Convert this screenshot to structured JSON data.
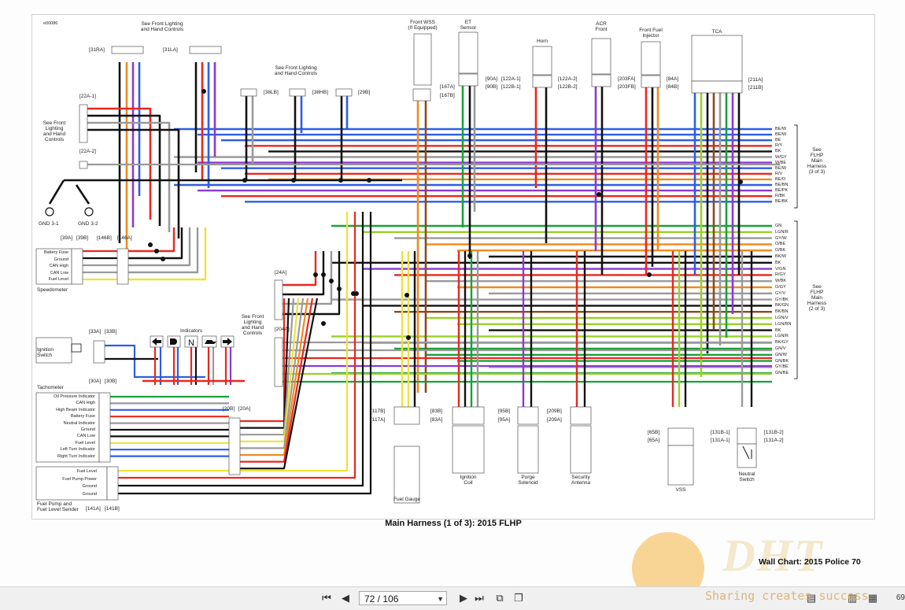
{
  "document": {
    "id_label": "e00086",
    "title": "Main Harness (1 of 3): 2015 FLHP",
    "footer": "Wall Chart:  2015 Police  70"
  },
  "labels": {
    "front_lighting_1": "See Front Lighting\nand Hand Controls",
    "front_lighting_2": "See Front Lighting\nand Hand Controls",
    "front_lighting_3": "See Front\nLighting\nand Hand\nControls",
    "front_lighting_4": "See Front\nLighting\nand Hand\nControls",
    "front_wss": "Front WSS\n(If Equipped)",
    "et_sensor": "ET\nSensor",
    "horn": "Horn",
    "acr_front": "ACR\nFront",
    "front_fuel_injector": "Front Fuel\nInjector",
    "tca": "TCA",
    "flhp_3": "See\nFLHP\nMain\nHarness\n(3 of 3)",
    "flhp_2": "See\nFLHP\nMain\nHarness\n(2 of 3)",
    "gnd_31": "GND 3-1",
    "gnd_32": "GND 3-2",
    "speedometer": "Speedometer",
    "ignition_switch": "Ignition\nSwitch",
    "indicators": "Indicators",
    "tachometer": "Tachometer",
    "fuel_pump": "Fuel Pump and\nFuel Level Sender",
    "fuel_gauge": "Fuel Gauge",
    "ignition_coil": "Ignition\nCoil",
    "purge_solenoid": "Purge\nSolenoid",
    "security_antenna": "Security\nAntenna",
    "vss": "VSS",
    "neutral_switch": "Neutral\nSwitch"
  },
  "connectors": {
    "c31ra": "[31RA]",
    "c31la": "[31LA]",
    "c38lb": "[38LB]",
    "c38hb": "[38HB]",
    "c29b": "[29B]",
    "c167a": "[167A]",
    "c167b": "[167B]",
    "c90a": "[90A]",
    "c90b": "[90B]",
    "c122a1": "[122A-1]",
    "c122b1": "[122B-1]",
    "c122a2": "[122A-2]",
    "c122b2": "[122B-2]",
    "c203fa": "[203FA]",
    "c203fb": "[203FB]",
    "c84a": "[84A]",
    "c84b": "[84B]",
    "c211a": "[211A]",
    "c211b": "[211B]",
    "c22a1": "[22A-1]",
    "c22a2": "[22A-2]",
    "c39a": "[39A]",
    "c39b": "[39B]",
    "c146b": "[146B]",
    "c146a": "[146A]",
    "c24a": "[24A]",
    "c204a": "[204A]",
    "c33a": "[33A]",
    "c33b": "[33B]",
    "c30a": "[30A]",
    "c30b": "[30B]",
    "c20b": "[20B]",
    "c20a": "[20A]",
    "c117b": "[117B]",
    "c117a": "[117A]",
    "c83b": "[83B]",
    "c83a": "[83A]",
    "c95b": "[95B]",
    "c95a": "[95A]",
    "c209b": "[209B]",
    "c209a": "[209A]",
    "c65b": "[65B]",
    "c65a": "[65A]",
    "c131b1": "[131B-1]",
    "c131a1": "[131A-1]",
    "c131b2": "[131B-2]",
    "c131a2": "[131A-2]",
    "c141a": "[141A]",
    "c141b": "[141B]"
  },
  "speedometer_pins": [
    "Battery Fuse",
    "Ground",
    "CAN High",
    "CAN Low",
    "Fuel Level"
  ],
  "tach_pins": [
    "Oil Pressure Indicator",
    "CAN High",
    "High Beam Indicator",
    "Battery Fuse",
    "Neutral Indicator",
    "Ground",
    "CAN Low",
    "Fuel Level",
    "Left Turn Indicator",
    "Right Turn Indicator"
  ],
  "fuel_pins": [
    "Fuel Level",
    "Fuel Pump Power",
    "Ground",
    "Ground"
  ],
  "right_wires_3": [
    "BE/W",
    "BE/W",
    "BE",
    "R/Y",
    "BK",
    "W/GY",
    "W/BE",
    "BE/W",
    "R/V",
    "BE/O",
    "BE/BN",
    "BE/PK",
    "R/BK",
    "BE/BK"
  ],
  "right_wires_2": [
    "GN",
    "LGN/R",
    "GY/W",
    "O/BE",
    "O/BK",
    "BK/W",
    "BK",
    "V/GN",
    "R/GY",
    "W/BK",
    "O/GY",
    "GY/V",
    "GY/BK",
    "BK/GN",
    "BK/BN",
    "LGN/V",
    "LGN/BN",
    "BK",
    "LGN/R",
    "BK/GY",
    "GN/V",
    "GN/W",
    "GN/BK",
    "GY/BE",
    "GN/BE"
  ],
  "toolbar": {
    "page_value": "72 / 106",
    "zoom": "69"
  },
  "watermark": "Sharing creates success",
  "logo": "DHT",
  "colors": {
    "red": "#e8281e",
    "black": "#111111",
    "blue": "#2e5de6",
    "dkblue": "#1f3fb0",
    "green": "#18a23a",
    "orange": "#f08a1e",
    "yellow": "#ece23a",
    "violet": "#8a3ad0",
    "gray": "#9a9a9a",
    "brown": "#8b4a1e",
    "lgreen": "#9ad02a",
    "pink": "#e86aa0",
    "white": "#e8e8e8"
  }
}
